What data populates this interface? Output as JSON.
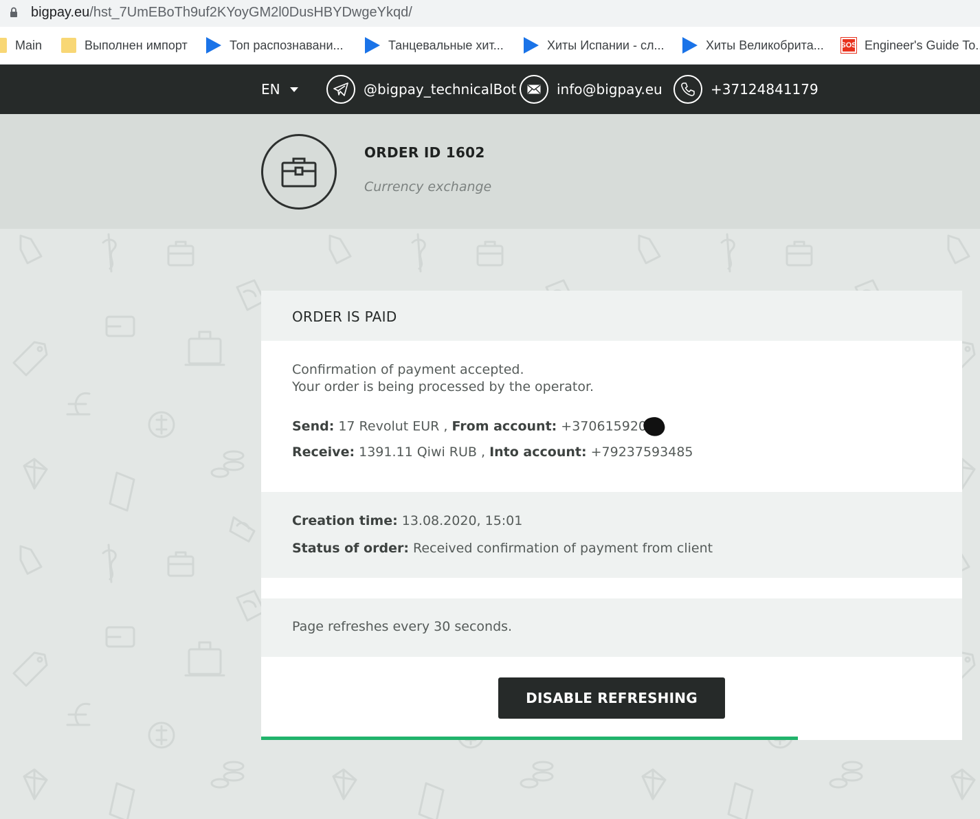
{
  "browser": {
    "url_host": "bigpay.eu",
    "url_path": "/hst_7UmEBoTh9uf2KYoyGM2l0DusHBYDwgeYkqd/",
    "bookmarks": [
      {
        "label": "Main",
        "icon": "folder-icon"
      },
      {
        "label": "Выполнен импорт",
        "icon": "folder-icon"
      },
      {
        "label": "Топ распознавани...",
        "icon": "play-icon"
      },
      {
        "label": "Танцевальные хит...",
        "icon": "play-icon"
      },
      {
        "label": "Хиты Испании - сл...",
        "icon": "play-icon"
      },
      {
        "label": "Хиты Великобрита...",
        "icon": "play-icon"
      },
      {
        "label": "Engineer's Guide To...",
        "icon": "sos-icon"
      }
    ],
    "sos_text": "SOS"
  },
  "topbar": {
    "language": "EN",
    "telegram": "@bigpay_technicalBot",
    "email": "info@bigpay.eu",
    "phone": "+37124841179"
  },
  "order": {
    "title": "ORDER ID 1602",
    "subtitle": "Currency exchange"
  },
  "card": {
    "status": "ORDER IS PAID",
    "confirm_line1": "Confirmation of payment accepted.",
    "confirm_line2": "Your order is being processed by the operator.",
    "send_label": "Send:",
    "send_value": " 17 Revolut EUR , ",
    "from_label": "From account:",
    "from_value": " +370615920",
    "receive_label": "Receive:",
    "receive_value": " 1391.11 Qiwi RUB , ",
    "into_label": "Into account:",
    "into_value": " +79237593485",
    "creation_label": "Creation time:",
    "creation_value": " 13.08.2020, 15:01",
    "status_label": "Status of order:",
    "status_value": " Received confirmation of payment from client",
    "refresh_note": "Page refreshes every 30 seconds.",
    "button_label": "DISABLE REFRESHING",
    "refresh_progress": 0.766
  },
  "colors": {
    "topbar": "#262a29",
    "progress": "#21b36b",
    "header_bg": "#d7dcd9"
  }
}
